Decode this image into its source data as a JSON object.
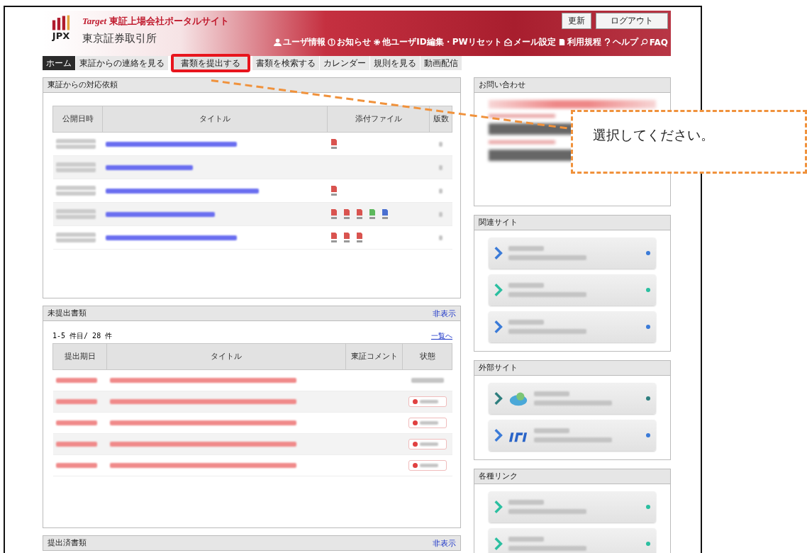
{
  "header": {
    "brand": "Target",
    "portal_name": "東証上場会社ポータルサイト",
    "logo_text": "JPX",
    "org_name": "東京証券取引所",
    "buttons": [
      "更新",
      "ログアウト"
    ],
    "links": [
      {
        "kind": "user",
        "label": "ユーザ情報"
      },
      {
        "kind": "info",
        "label": "お知らせ"
      },
      {
        "kind": "gear",
        "label": "他ユーザID編集・PWリセット"
      },
      {
        "kind": "mail",
        "label": "メール設定"
      },
      {
        "kind": "book",
        "label": "利用規程"
      },
      {
        "kind": "help",
        "label": "ヘルプ"
      },
      {
        "kind": "search",
        "label": "FAQ"
      }
    ]
  },
  "nav": [
    {
      "label": "ホーム",
      "selected": true,
      "highlighted": false
    },
    {
      "label": "東証からの連絡を見る",
      "selected": false,
      "highlighted": false
    },
    {
      "label": "書類を提出する",
      "selected": false,
      "highlighted": true
    },
    {
      "label": "書類を検索する",
      "selected": false,
      "highlighted": false
    },
    {
      "label": "カレンダー",
      "selected": false,
      "highlighted": false
    },
    {
      "label": "規則を見る",
      "selected": false,
      "highlighted": false
    },
    {
      "label": "動画配信",
      "selected": false,
      "highlighted": false
    }
  ],
  "requests_panel": {
    "title": "東証からの対応依頼",
    "columns": [
      "公開日時",
      "タイトル",
      "添付ファイル",
      "版数"
    ],
    "rows": [
      {
        "attachments": [
          {
            "color": "#d9534f"
          }
        ]
      },
      {},
      {
        "attachments": [
          {
            "color": "#d9534f"
          }
        ]
      },
      {
        "attachments": [
          {
            "color": "#d9534f"
          },
          {
            "color": "#d9534f"
          },
          {
            "color": "#d9534f"
          },
          {
            "color": "#5cb85c"
          },
          {
            "color": "#4a6fd0"
          }
        ]
      },
      {
        "attachments": [
          {
            "color": "#d9534f"
          },
          {
            "color": "#d9534f"
          },
          {
            "color": "#d9534f"
          }
        ]
      }
    ]
  },
  "pending_panel": {
    "title": "未提出書類",
    "toggle": "非表示",
    "count": "1-5 件目/ 28 件",
    "list_link": "一覧へ",
    "columns": [
      "提出期日",
      "タイトル",
      "東証コメント",
      "状態"
    ],
    "rows": [
      {
        "kind": "plain"
      },
      {
        "kind": "button"
      },
      {
        "kind": "button"
      },
      {
        "kind": "button"
      },
      {
        "kind": "button"
      }
    ]
  },
  "submitted_panel": {
    "title": "提出済書類",
    "toggle": "非表示"
  },
  "contact_panel": {
    "title": "お問い合わせ"
  },
  "related_panel": {
    "title": "関連サイト",
    "cards": [
      {
        "color": "#3b7bd8"
      },
      {
        "color": "#2bbfa0"
      },
      {
        "color": "#3b7bd8"
      }
    ]
  },
  "external_panel": {
    "title": "外部サイト",
    "cards": [
      {
        "color": "#2f7f7f",
        "kind": "cloud"
      },
      {
        "color": "#3b7bd8",
        "kind": "letters"
      }
    ]
  },
  "links_panel": {
    "title": "各種リンク",
    "cards": [
      {
        "color": "#2bbfa0"
      },
      {
        "color": "#2bbfa0"
      }
    ]
  },
  "callout": {
    "text": "選択してください。"
  }
}
